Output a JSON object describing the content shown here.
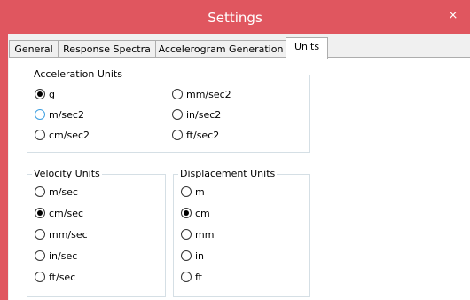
{
  "window": {
    "title": "Settings",
    "close_glyph": "×"
  },
  "tabs": [
    {
      "label": "General"
    },
    {
      "label": "Response Spectra"
    },
    {
      "label": "Accelerogram Generation"
    },
    {
      "label": "Units",
      "active": true
    }
  ],
  "acceleration": {
    "legend": "Acceleration Units",
    "options": [
      "g",
      "mm/sec2",
      "m/sec2",
      "in/sec2",
      "cm/sec2",
      "ft/sec2"
    ],
    "selected": "g"
  },
  "velocity": {
    "legend": "Velocity Units",
    "options": [
      "m/sec",
      "cm/sec",
      "mm/sec",
      "in/sec",
      "ft/sec"
    ],
    "selected": "cm/sec"
  },
  "displacement": {
    "legend": "Displacement Units",
    "options": [
      "m",
      "cm",
      "mm",
      "in",
      "ft"
    ],
    "selected": "cm"
  },
  "colors": {
    "titlebar": "#e0565f",
    "focus": "#3c9ee0"
  }
}
